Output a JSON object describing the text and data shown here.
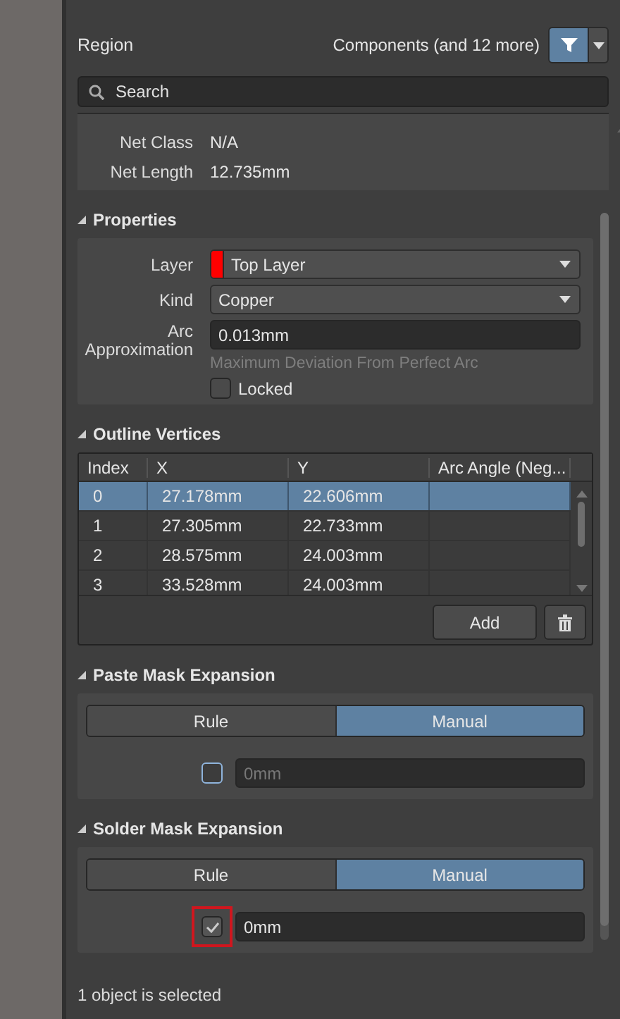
{
  "header": {
    "object_type": "Region",
    "filter_label": "Components (and 12 more)"
  },
  "search": {
    "placeholder": "Search"
  },
  "net": [
    {
      "label": "Net Class",
      "value": "N/A"
    },
    {
      "label": "Net Length",
      "value": "12.735mm"
    }
  ],
  "properties": {
    "title": "Properties",
    "expanded": true,
    "layer": {
      "label": "Layer",
      "value": "Top Layer",
      "color": "#ff0000"
    },
    "kind": {
      "label": "Kind",
      "value": "Copper"
    },
    "arc": {
      "label": "Arc Approximation",
      "value": "0.013mm",
      "hint": "Maximum Deviation From Perfect Arc"
    },
    "locked": {
      "label": "Locked",
      "checked": false
    }
  },
  "outline": {
    "title": "Outline Vertices",
    "expanded": true,
    "columns": [
      "Index",
      "X",
      "Y",
      "Arc Angle (Neg..."
    ],
    "rows": [
      {
        "cells": [
          "0",
          "27.178mm",
          "22.606mm",
          ""
        ],
        "selected": true
      },
      {
        "cells": [
          "1",
          "27.305mm",
          "22.733mm",
          ""
        ],
        "selected": false
      },
      {
        "cells": [
          "2",
          "28.575mm",
          "24.003mm",
          ""
        ],
        "selected": false
      },
      {
        "cells": [
          "3",
          "33.528mm",
          "24.003mm",
          ""
        ],
        "selected": false
      }
    ],
    "add_button": "Add"
  },
  "masks": [
    {
      "title": "Paste Mask Expansion",
      "expanded": true,
      "options": [
        {
          "label": "Rule",
          "selected": false
        },
        {
          "label": "Manual",
          "selected": true
        }
      ],
      "checked": false,
      "highlighted": false,
      "value": "0mm"
    },
    {
      "title": "Solder Mask Expansion",
      "expanded": true,
      "options": [
        {
          "label": "Rule",
          "selected": false
        },
        {
          "label": "Manual",
          "selected": true
        }
      ],
      "checked": true,
      "highlighted": true,
      "value": "0mm"
    }
  ],
  "status": "1 object is selected"
}
